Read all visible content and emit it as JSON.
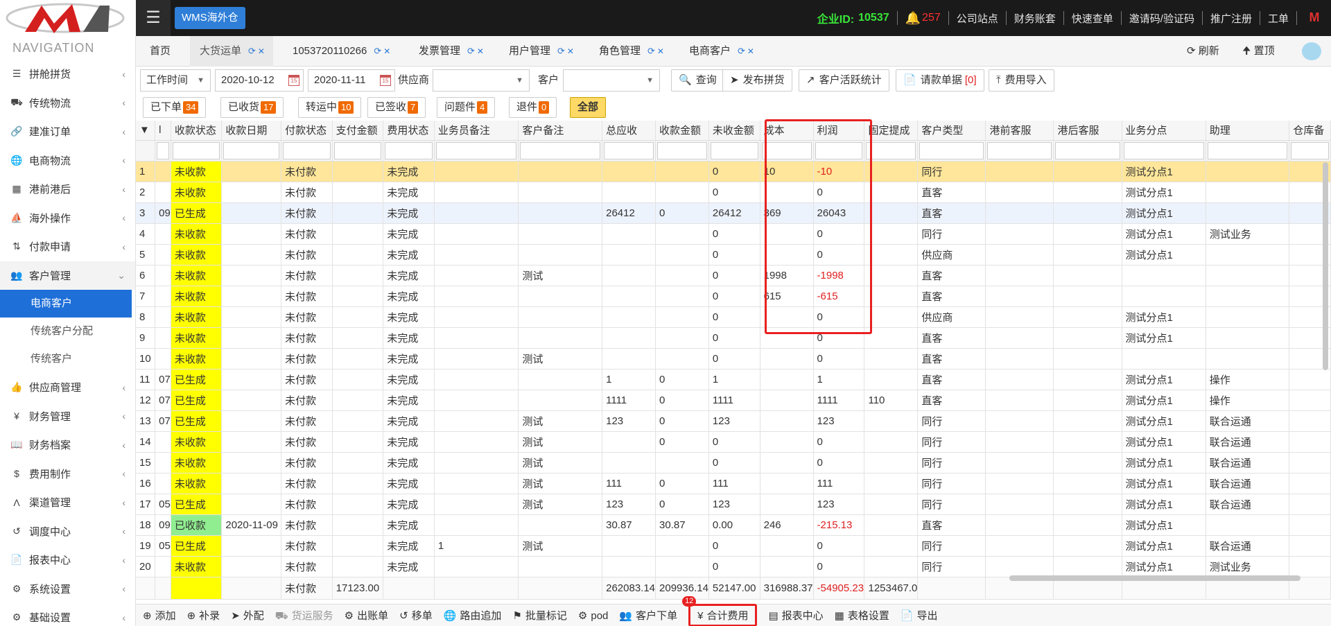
{
  "header": {
    "wms_label": "WMS海外仓",
    "company_label": "企业ID:",
    "company_id": "10537",
    "notification_count": "257",
    "links": [
      "公司站点",
      "财务账套",
      "快速查单",
      "邀请码/验证码",
      "推广注册",
      "工单"
    ]
  },
  "sidebar": {
    "title": "NAVIGATION",
    "items": [
      {
        "label": "拼舱拼货",
        "icon": "list-icon"
      },
      {
        "label": "传统物流",
        "icon": "truck-icon"
      },
      {
        "label": "建准订单",
        "icon": "link-icon"
      },
      {
        "label": "电商物流",
        "icon": "globe-icon"
      },
      {
        "label": "港前港后",
        "icon": "cubes-icon"
      },
      {
        "label": "海外操作",
        "icon": "ship-icon"
      },
      {
        "label": "付款申请",
        "icon": "sort-icon"
      },
      {
        "label": "客户管理",
        "icon": "users-icon"
      }
    ],
    "sub_items": [
      "电商客户",
      "传统客户分配",
      "传统客户"
    ],
    "items_after": [
      {
        "label": "供应商管理",
        "icon": "thumbs-up-icon"
      },
      {
        "label": "财务管理",
        "icon": "yen-icon"
      },
      {
        "label": "财务档案",
        "icon": "book-icon"
      },
      {
        "label": "费用制作",
        "icon": "dollar-icon"
      },
      {
        "label": "渠道管理",
        "icon": "road-icon"
      },
      {
        "label": "调度中心",
        "icon": "retweet-icon"
      },
      {
        "label": "报表中心",
        "icon": "file-icon"
      },
      {
        "label": "系统设置",
        "icon": "cog-icon"
      },
      {
        "label": "基础设置",
        "icon": "cog-icon"
      }
    ]
  },
  "tabs": [
    "首页",
    "大货运单",
    "1053720110266",
    "发票管理",
    "用户管理",
    "角色管理",
    "电商客户"
  ],
  "tab_actions": {
    "refresh": "刷新",
    "top": "置顶"
  },
  "toolbar": {
    "time_type": "工作时间",
    "date_from": "2020-10-12",
    "date_to": "2020-11-11",
    "supplier_label": "供应商",
    "customer_label": "客户",
    "query": "查询",
    "publish": "发布拼货",
    "activity": "客户活跃统计",
    "payment_request": "请款单据",
    "payment_request_count": "[0]",
    "fee_import": "费用导入"
  },
  "status_buttons": [
    {
      "label": "已下单",
      "count": "34"
    },
    {
      "label": "已收货",
      "count": "17"
    },
    {
      "label": "转运中",
      "count": "10"
    },
    {
      "label": "已签收",
      "count": "7"
    },
    {
      "label": "问题件",
      "count": "4"
    },
    {
      "label": "退件",
      "count": "0"
    },
    {
      "label": "全部",
      "count": ""
    }
  ],
  "grid": {
    "columns": [
      "",
      "l",
      "收款状态",
      "收款日期",
      "付款状态",
      "支付金额",
      "费用状态",
      "业务员备注",
      "客户备注",
      "总应收",
      "收款金额",
      "未收金额",
      "成本",
      "利润",
      "固定提成",
      "客户类型",
      "港前客服",
      "港后客服",
      "业务分点",
      "助理",
      "仓库备"
    ],
    "rows": [
      [
        "1",
        "",
        "未收款",
        "",
        "未付款",
        "",
        "未完成",
        "",
        "",
        "",
        "",
        "0",
        "10",
        "-10",
        "",
        "同行",
        "",
        "",
        "测试分点1",
        "",
        ""
      ],
      [
        "2",
        "",
        "未收款",
        "",
        "未付款",
        "",
        "未完成",
        "",
        "",
        "",
        "",
        "0",
        "",
        "0",
        "",
        "直客",
        "",
        "",
        "测试分点1",
        "",
        ""
      ],
      [
        "3",
        "09",
        "已生成",
        "",
        "未付款",
        "",
        "未完成",
        "",
        "",
        "26412",
        "0",
        "26412",
        "369",
        "26043",
        "",
        "直客",
        "",
        "",
        "测试分点1",
        "",
        ""
      ],
      [
        "4",
        "",
        "未收款",
        "",
        "未付款",
        "",
        "未完成",
        "",
        "",
        "",
        "",
        "0",
        "",
        "0",
        "",
        "同行",
        "",
        "",
        "测试分点1",
        "测试业务",
        ""
      ],
      [
        "5",
        "",
        "未收款",
        "",
        "未付款",
        "",
        "未完成",
        "",
        "",
        "",
        "",
        "0",
        "",
        "0",
        "",
        "供应商",
        "",
        "",
        "测试分点1",
        "",
        ""
      ],
      [
        "6",
        "",
        "未收款",
        "",
        "未付款",
        "",
        "未完成",
        "",
        "测试",
        "",
        "",
        "0",
        "1998",
        "-1998",
        "",
        "直客",
        "",
        "",
        "",
        "",
        ""
      ],
      [
        "7",
        "",
        "未收款",
        "",
        "未付款",
        "",
        "未完成",
        "",
        "",
        "",
        "",
        "0",
        "615",
        "-615",
        "",
        "直客",
        "",
        "",
        "",
        "",
        ""
      ],
      [
        "8",
        "",
        "未收款",
        "",
        "未付款",
        "",
        "未完成",
        "",
        "",
        "",
        "",
        "0",
        "",
        "0",
        "",
        "供应商",
        "",
        "",
        "测试分点1",
        "",
        ""
      ],
      [
        "9",
        "",
        "未收款",
        "",
        "未付款",
        "",
        "未完成",
        "",
        "",
        "",
        "",
        "0",
        "",
        "0",
        "",
        "直客",
        "",
        "",
        "测试分点1",
        "",
        ""
      ],
      [
        "10",
        "",
        "未收款",
        "",
        "未付款",
        "",
        "未完成",
        "",
        "测试",
        "",
        "",
        "0",
        "",
        "0",
        "",
        "直客",
        "",
        "",
        "",
        "",
        ""
      ],
      [
        "11",
        "07",
        "已生成",
        "",
        "未付款",
        "",
        "未完成",
        "",
        "",
        "1",
        "0",
        "1",
        "",
        "1",
        "",
        "直客",
        "",
        "",
        "测试分点1",
        "操作",
        ""
      ],
      [
        "12",
        "07",
        "已生成",
        "",
        "未付款",
        "",
        "未完成",
        "",
        "",
        "1111",
        "0",
        "1111",
        "",
        "1111",
        "110",
        "直客",
        "",
        "",
        "测试分点1",
        "操作",
        ""
      ],
      [
        "13",
        "07",
        "已生成",
        "",
        "未付款",
        "",
        "未完成",
        "",
        "测试",
        "123",
        "0",
        "123",
        "",
        "123",
        "",
        "同行",
        "",
        "",
        "测试分点1",
        "联合运通",
        ""
      ],
      [
        "14",
        "",
        "未收款",
        "",
        "未付款",
        "",
        "未完成",
        "",
        "测试",
        "",
        "0",
        "0",
        "",
        "0",
        "",
        "同行",
        "",
        "",
        "测试分点1",
        "联合运通",
        ""
      ],
      [
        "15",
        "",
        "未收款",
        "",
        "未付款",
        "",
        "未完成",
        "",
        "测试",
        "",
        "",
        "0",
        "",
        "0",
        "",
        "同行",
        "",
        "",
        "测试分点1",
        "联合运通",
        ""
      ],
      [
        "16",
        "",
        "未收款",
        "",
        "未付款",
        "",
        "未完成",
        "",
        "测试",
        "111",
        "0",
        "111",
        "",
        "111",
        "",
        "同行",
        "",
        "",
        "测试分点1",
        "联合运通",
        ""
      ],
      [
        "17",
        "05",
        "已生成",
        "",
        "未付款",
        "",
        "未完成",
        "",
        "测试",
        "123",
        "0",
        "123",
        "",
        "123",
        "",
        "同行",
        "",
        "",
        "测试分点1",
        "联合运通",
        ""
      ],
      [
        "18",
        "09",
        "已收款",
        "2020-11-09",
        "未付款",
        "",
        "未完成",
        "",
        "",
        "30.87",
        "30.87",
        "0.00",
        "246",
        "-215.13",
        "",
        "直客",
        "",
        "",
        "测试分点1",
        "",
        ""
      ],
      [
        "19",
        "05",
        "已生成",
        "",
        "未付款",
        "",
        "未完成",
        "1",
        "测试",
        "",
        "",
        "0",
        "",
        "0",
        "",
        "同行",
        "",
        "",
        "测试分点1",
        "联合运通",
        ""
      ],
      [
        "20",
        "",
        "未收款",
        "",
        "未付款",
        "",
        "未完成",
        "",
        "",
        "",
        "",
        "0",
        "",
        "0",
        "",
        "同行",
        "",
        "",
        "测试分点1",
        "测试业务",
        ""
      ]
    ],
    "summary": [
      "",
      "",
      "",
      "",
      "未付款",
      "17123.00",
      "",
      "",
      "",
      "262083.14",
      "209936.14",
      "52147.00",
      "316988.37",
      "-54905.23",
      "1253467.0",
      "",
      "",
      "",
      "",
      "",
      ""
    ]
  },
  "bottom_actions": [
    {
      "label": "添加",
      "icon": "plus-circle-icon"
    },
    {
      "label": "补录",
      "icon": "plus-circle-icon"
    },
    {
      "label": "外配",
      "icon": "send-icon"
    },
    {
      "label": "货运服务",
      "icon": "truck-icon"
    },
    {
      "label": "出账单",
      "icon": "cog-icon"
    },
    {
      "label": "移单",
      "icon": "retweet-icon"
    },
    {
      "label": "路由追加",
      "icon": "globe-icon"
    },
    {
      "label": "批量标记",
      "icon": "tag-icon"
    },
    {
      "label": "pod",
      "icon": "cog-icon"
    },
    {
      "label": "客户下单",
      "icon": "users-icon"
    },
    {
      "label": "合计费用",
      "icon": "yen-icon",
      "count": "12"
    },
    {
      "label": "报表中心",
      "icon": "bar-chart-icon"
    },
    {
      "label": "表格设置",
      "icon": "table-icon"
    },
    {
      "label": "导出",
      "icon": "file-icon"
    }
  ],
  "colors": {
    "accent": "#1e6fd8",
    "unpaid_cell": "#ffff00",
    "paid_cell": "#90ee90",
    "selected_row": "#ffe69a",
    "negative": "#e02020",
    "highlight_box": "#e82020"
  }
}
